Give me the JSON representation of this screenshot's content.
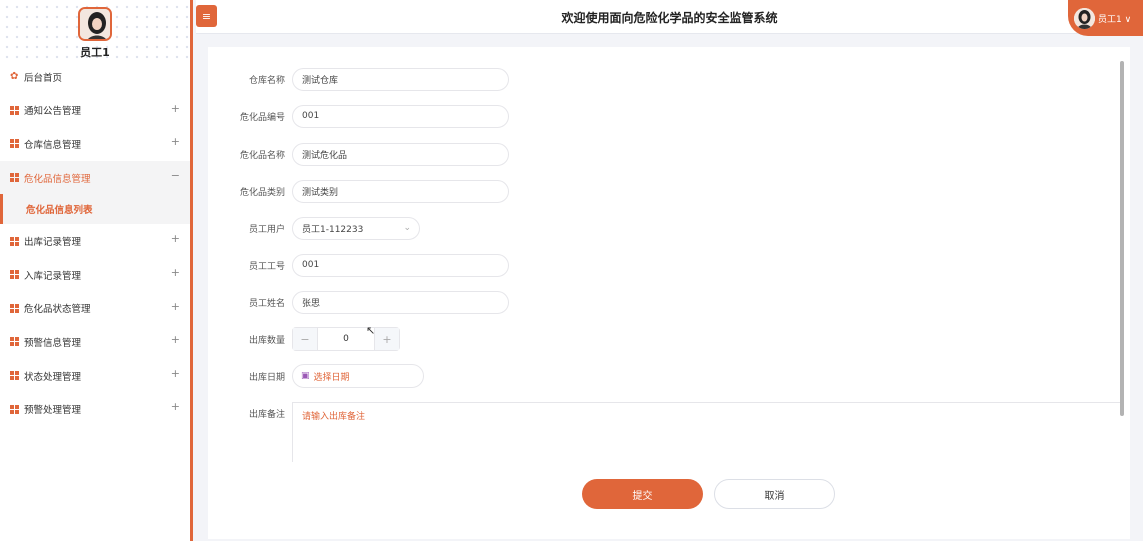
{
  "sidebar": {
    "user_name": "员工1",
    "home_label": "后台首页",
    "items": [
      {
        "label": "通知公告管理",
        "toggle": "+"
      },
      {
        "label": "仓库信息管理",
        "toggle": "+"
      },
      {
        "label": "危化品信息管理",
        "toggle": "−"
      },
      {
        "label": "出库记录管理",
        "toggle": "+"
      },
      {
        "label": "入库记录管理",
        "toggle": "+"
      },
      {
        "label": "危化品状态管理",
        "toggle": "+"
      },
      {
        "label": "预警信息管理",
        "toggle": "+"
      },
      {
        "label": "状态处理管理",
        "toggle": "+"
      },
      {
        "label": "预警处理管理",
        "toggle": "+"
      }
    ],
    "submenu_label": "危化品信息列表"
  },
  "header": {
    "title": "欢迎使用面向危险化学品的安全监管系统",
    "user_label": "员工1 ∨"
  },
  "form": {
    "warehouse_name": {
      "label": "仓库名称",
      "value": "测试仓库"
    },
    "hazmat_code": {
      "label": "危化品编号",
      "value": "001"
    },
    "hazmat_name": {
      "label": "危化品名称",
      "value": "测试危化品"
    },
    "hazmat_type": {
      "label": "危化品类别",
      "value": "测试类别"
    },
    "staff_user": {
      "label": "员工用户",
      "value": "员工1-112233"
    },
    "staff_no": {
      "label": "员工工号",
      "value": "001"
    },
    "staff_name": {
      "label": "员工姓名",
      "value": "张思"
    },
    "out_qty": {
      "label": "出库数量",
      "value": "0",
      "minus": "−",
      "plus": "+"
    },
    "out_date": {
      "label": "出库日期",
      "placeholder": "选择日期"
    },
    "out_note": {
      "label": "出库备注",
      "placeholder": "请输入出库备注"
    },
    "submit_label": "提交",
    "cancel_label": "取消"
  },
  "colors": {
    "accent": "#e0663a"
  }
}
